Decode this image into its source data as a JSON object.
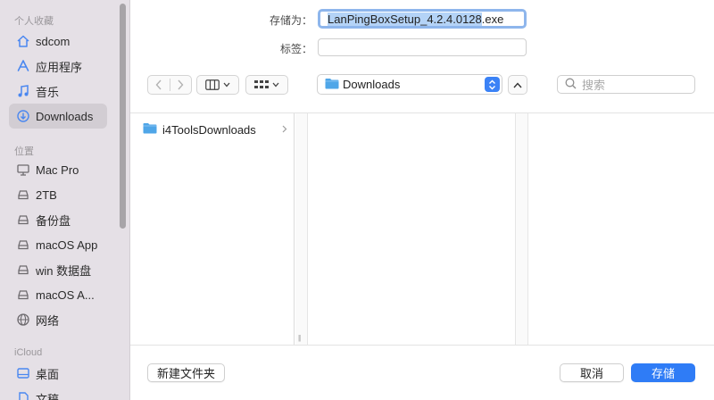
{
  "sidebar": {
    "sections": {
      "favorites": "个人收藏",
      "locations": "位置",
      "icloud": "iCloud"
    },
    "favorites": [
      {
        "label": "sdcom",
        "icon": "home-icon"
      },
      {
        "label": "应用程序",
        "icon": "applications-icon"
      },
      {
        "label": "音乐",
        "icon": "music-icon"
      },
      {
        "label": "Downloads",
        "icon": "downloads-icon",
        "selected": true
      }
    ],
    "locations": [
      {
        "label": "Mac Pro",
        "icon": "computer-icon"
      },
      {
        "label": "2TB",
        "icon": "drive-icon"
      },
      {
        "label": "备份盘",
        "icon": "drive-icon"
      },
      {
        "label": "macOS App",
        "icon": "drive-icon"
      },
      {
        "label": "win 数据盘",
        "icon": "drive-icon"
      },
      {
        "label": "macOS A...",
        "icon": "drive-icon"
      },
      {
        "label": "网络",
        "icon": "network-icon"
      }
    ],
    "icloud": [
      {
        "label": "桌面",
        "icon": "desktop-icon"
      },
      {
        "label": "文稿",
        "icon": "document-icon"
      }
    ]
  },
  "form": {
    "save_as_label": "存储为：",
    "filename_selected": "LanPingBoxSetup_4.2.4.0128",
    "filename_ext": ".exe",
    "tags_label": "标签：",
    "tags_value": ""
  },
  "toolbar": {
    "location": "Downloads",
    "search_placeholder": "搜索"
  },
  "browser": {
    "items": [
      {
        "name": "i4ToolsDownloads",
        "type": "folder"
      }
    ]
  },
  "buttons": {
    "new_folder": "新建文件夹",
    "cancel": "取消",
    "save": "存储"
  },
  "colors": {
    "accent": "#2f7cf6",
    "folder": "#4fa6e8",
    "sidebar_bg": "#e5e0e6"
  }
}
